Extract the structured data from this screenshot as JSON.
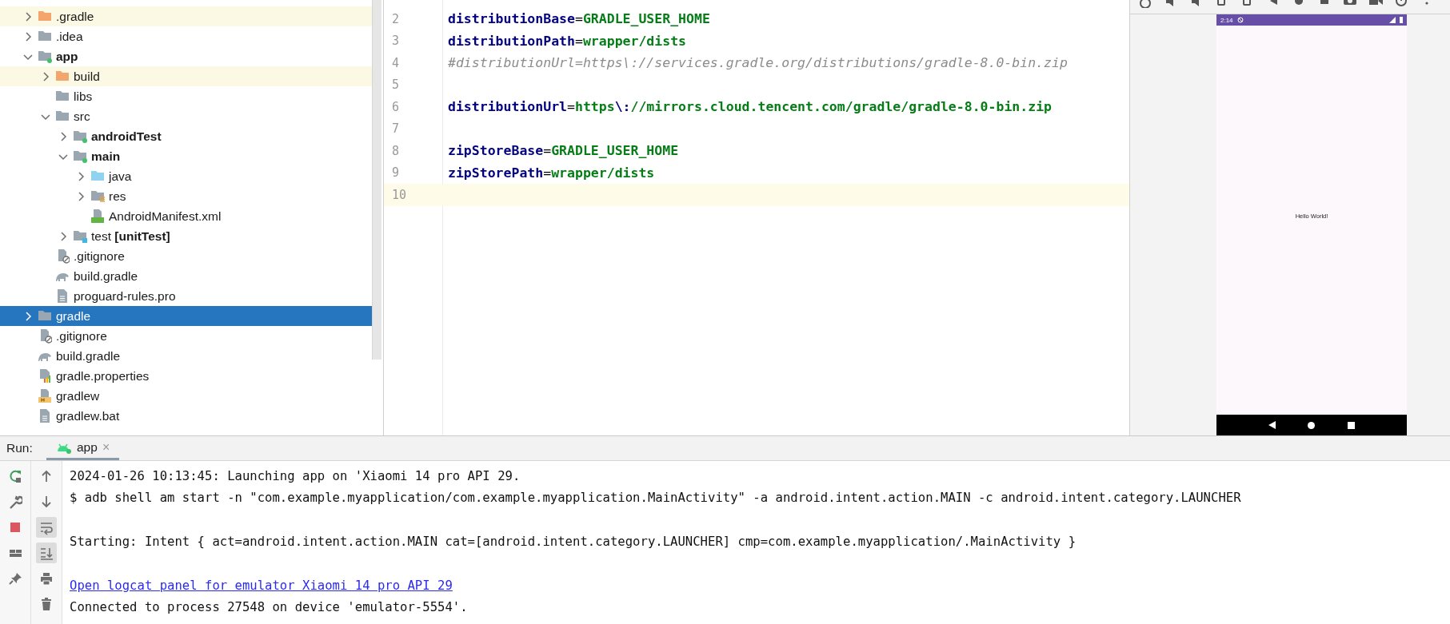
{
  "project_tree": [
    {
      "label": ".gradle",
      "kind": "folder-excluded",
      "expanded": false,
      "selected": false,
      "highlighted": true,
      "bold": false
    },
    {
      "label": ".idea",
      "kind": "folder",
      "expanded": false,
      "selected": false,
      "highlighted": false,
      "bold": false
    },
    {
      "label": "app",
      "kind": "module",
      "expanded": true,
      "selected": false,
      "highlighted": false,
      "bold": true,
      "children": [
        {
          "label": "build",
          "kind": "folder-excluded",
          "expanded": false,
          "selected": false,
          "highlighted": true,
          "bold": false
        },
        {
          "label": "libs",
          "kind": "folder",
          "selected": false,
          "highlighted": false,
          "bold": false
        },
        {
          "label": "src",
          "kind": "folder",
          "expanded": true,
          "selected": false,
          "highlighted": false,
          "bold": false,
          "children": [
            {
              "label": "androidTest",
              "kind": "module",
              "expanded": false,
              "selected": false,
              "highlighted": false,
              "bold": true
            },
            {
              "label": "main",
              "kind": "module",
              "expanded": true,
              "selected": false,
              "highlighted": false,
              "bold": true,
              "children": [
                {
                  "label": "java",
                  "kind": "folder-source",
                  "expanded": false,
                  "selected": false,
                  "highlighted": false,
                  "bold": false
                },
                {
                  "label": "res",
                  "kind": "folder-res",
                  "expanded": false,
                  "selected": false,
                  "highlighted": false,
                  "bold": false
                },
                {
                  "label": "AndroidManifest.xml",
                  "kind": "manifest",
                  "selected": false,
                  "highlighted": false,
                  "bold": false
                }
              ]
            },
            {
              "label": "test **[unitTest]**",
              "kind": "folder-test",
              "expanded": false,
              "selected": false,
              "highlighted": false,
              "bold": false
            }
          ]
        },
        {
          "label": ".gitignore",
          "kind": "ignore-file",
          "selected": false,
          "highlighted": false,
          "bold": false
        },
        {
          "label": "build.gradle",
          "kind": "gradle-file",
          "selected": false,
          "highlighted": false,
          "bold": false
        },
        {
          "label": "proguard-rules.pro",
          "kind": "text-file",
          "selected": false,
          "highlighted": false,
          "bold": false
        }
      ]
    },
    {
      "label": "gradle",
      "kind": "folder",
      "expanded": false,
      "selected": true,
      "highlighted": false,
      "bold": false
    },
    {
      "label": ".gitignore",
      "kind": "ignore-file",
      "selected": false,
      "highlighted": false,
      "bold": false
    },
    {
      "label": "build.gradle",
      "kind": "gradle-file",
      "selected": false,
      "highlighted": false,
      "bold": false
    },
    {
      "label": "gradle.properties",
      "kind": "properties-file",
      "selected": false,
      "highlighted": false,
      "bold": false
    },
    {
      "label": "gradlew",
      "kind": "shell-file",
      "selected": false,
      "highlighted": false,
      "bold": false
    },
    {
      "label": "gradlew.bat",
      "kind": "text-file",
      "selected": false,
      "highlighted": false,
      "bold": false
    }
  ],
  "editor": {
    "lines": [
      {
        "number": "2",
        "current": false,
        "tokens": [
          {
            "kind": "key",
            "text": "distributionBase"
          },
          {
            "kind": "sep",
            "text": "="
          },
          {
            "kind": "value",
            "text": "GRADLE_USER_HOME"
          }
        ]
      },
      {
        "number": "3",
        "current": false,
        "tokens": [
          {
            "kind": "key",
            "text": "distributionPath"
          },
          {
            "kind": "sep",
            "text": "="
          },
          {
            "kind": "value",
            "text": "wrapper/dists"
          }
        ]
      },
      {
        "number": "4",
        "current": false,
        "tokens": [
          {
            "kind": "comment",
            "text": "#distributionUrl=https\\://services.gradle.org/distributions/gradle-8.0-bin.zip"
          }
        ]
      },
      {
        "number": "5",
        "current": false
      },
      {
        "number": "6",
        "current": false,
        "tokens": [
          {
            "kind": "key",
            "text": "distributionUrl"
          },
          {
            "kind": "sep",
            "text": "="
          },
          {
            "kind": "value",
            "text": "https"
          },
          {
            "kind": "escape",
            "text": "\\:"
          },
          {
            "kind": "value",
            "text": "//mirrors.cloud.tencent.com/gradle/gradle-8.0-bin.zip"
          }
        ]
      },
      {
        "number": "7",
        "current": false
      },
      {
        "number": "8",
        "current": false,
        "tokens": [
          {
            "kind": "key",
            "text": "zipStoreBase"
          },
          {
            "kind": "sep",
            "text": "="
          },
          {
            "kind": "value",
            "text": "GRADLE_USER_HOME"
          }
        ]
      },
      {
        "number": "9",
        "current": false,
        "tokens": [
          {
            "kind": "key",
            "text": "zipStorePath"
          },
          {
            "kind": "sep",
            "text": "="
          },
          {
            "kind": "value",
            "text": "wrapper/dists"
          }
        ]
      },
      {
        "number": "10",
        "current": true
      }
    ]
  },
  "emulator": {
    "status_time": "2:14",
    "screen_text": "Hello World!"
  },
  "run_panel": {
    "label": "Run:",
    "tab": {
      "label": "app",
      "close": "×",
      "selected": true
    },
    "tools_left": [
      {
        "kind": "rerun"
      },
      {
        "kind": "wrench"
      },
      {
        "kind": "stop"
      },
      {
        "kind": "layout"
      },
      {
        "kind": "pin"
      }
    ],
    "tools_right": [
      {
        "kind": "up",
        "on": false
      },
      {
        "kind": "down",
        "on": false
      },
      {
        "kind": "wrap",
        "on": true
      },
      {
        "kind": "scroll-end",
        "on": true
      },
      {
        "kind": "print",
        "on": false
      },
      {
        "kind": "trash",
        "on": false
      }
    ],
    "console": [
      {
        "kind": "text",
        "text": "2024-01-26 10:13:45: Launching app on 'Xiaomi 14 pro API 29."
      },
      {
        "kind": "text",
        "text": "$ adb shell am start -n \"com.example.myapplication/com.example.myapplication.MainActivity\" -a android.intent.action.MAIN -c android.intent.category.LAUNCHER"
      },
      {
        "kind": "gap"
      },
      {
        "kind": "text",
        "text": "Starting: Intent { act=android.intent.action.MAIN cat=[android.intent.category.LAUNCHER] cmp=com.example.myapplication/.MainActivity }"
      },
      {
        "kind": "gap"
      },
      {
        "kind": "link",
        "text": "Open logcat panel for emulator Xiaomi 14 pro API 29"
      },
      {
        "kind": "text",
        "text": "Connected to process 27548 on device 'emulator-5554'."
      }
    ]
  }
}
